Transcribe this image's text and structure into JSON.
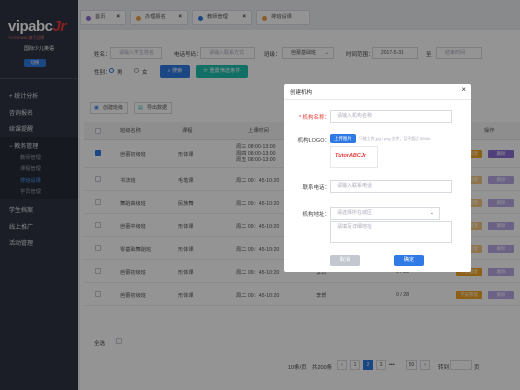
{
  "brand": {
    "logo_main": "vipabc",
    "logo_jr": "Jr",
    "logo_sub": "TUTORABC旗下品牌",
    "school": "国际少儿英语",
    "switch_label": "切换"
  },
  "sidebar": {
    "items": [
      {
        "label": "统计分析",
        "arrow": "+"
      },
      {
        "label": "咨询报名"
      },
      {
        "label": "续课提醒"
      },
      {
        "label": "教务管理",
        "arrow": "−"
      },
      {
        "label": "教师管理"
      },
      {
        "label": "课程管理"
      },
      {
        "label": "排班设课"
      },
      {
        "label": "学员管理"
      },
      {
        "label": "学生档案"
      },
      {
        "label": "线上推广"
      },
      {
        "label": "活动管理"
      }
    ]
  },
  "tabs": [
    {
      "label": "首页",
      "color": "#8e6fd6"
    },
    {
      "label": "办理报名",
      "color": "#f0a04b"
    },
    {
      "label": "教师管理",
      "color": "#2f7ae5"
    },
    {
      "label": "排班设课",
      "color": "#f0a04b"
    }
  ],
  "filters": {
    "name_label": "姓名：",
    "name_placeholder": "请输入学生姓名",
    "phone_label": "电话号码：",
    "phone_placeholder": "请输入联系方式",
    "class_label": "班级：",
    "class_value": "芭蕾基础班",
    "time_label": "时间范围：",
    "time_start": "2017-5-31",
    "time_sep": "至",
    "time_end_placeholder": "结束时间",
    "gender_label": "性别：",
    "gender_male": "男",
    "gender_female": "女",
    "search_button": "搜索",
    "reset_button": "重置筛选条件"
  },
  "toolbar": {
    "create_button": "创建班级",
    "export_button": "导出数据"
  },
  "table": {
    "headers": [
      "班级名称",
      "课程",
      "上课时间",
      "",
      "",
      "",
      "操作"
    ],
    "rows": [
      {
        "name": "芭蕾初级班",
        "course": "形体课",
        "time": "周三 08:00-13:00\n周四 08:00-13:00\n周五 08:00-13:00",
        "checked": true
      },
      {
        "name": "书法班",
        "course": "毛笔课",
        "time": "周二 09：45-10:20",
        "checked": false
      },
      {
        "name": "舞蹈高级班",
        "course": "民族舞",
        "time": "周二 09：45-10:20",
        "checked": false
      },
      {
        "name": "芭蕾中级班",
        "course": "形体课",
        "time": "周二 09：45-10:20",
        "checked": false
      },
      {
        "name": "零基础舞蹈班",
        "course": "形体课",
        "time": "周二 09：45-10:20",
        "checked": false
      },
      {
        "name": "芭蕾初级班",
        "course": "形体课",
        "time": "周二 09：45-10:20",
        "teacher": "李贺",
        "count": "0 / 28",
        "checked": false
      },
      {
        "name": "芭蕾初级班",
        "course": "形体课",
        "time": "周二 09：45-10:20",
        "teacher": "李贺",
        "count": "0 / 28",
        "checked": false
      }
    ],
    "action_manage": "学员管理",
    "action_delete": "删除",
    "select_all": "全选"
  },
  "pager": {
    "per_page": "10条/页",
    "total": "共200条",
    "pages": [
      "1",
      "2",
      "3",
      "•••",
      "50"
    ],
    "goto_label": "转到",
    "goto_suffix": "页"
  },
  "modal": {
    "title": "创建机构",
    "name_label": "* 机构名称：",
    "name_placeholder": "请输入机构名称",
    "logo_label": "机构LOGO：",
    "upload_button": "上传图片",
    "upload_hint": "只能上传 jpg / png 文件，且不超过 500kb",
    "logo_preview": "TutorABCJr",
    "phone_label": "联系电话：",
    "phone_placeholder": "请输入联系电话",
    "address_label": "机构地址：",
    "address_placeholder": "请选择所在城区",
    "address_detail_placeholder": "请填写详细地址",
    "cancel_button": "取消",
    "confirm_button": "确定"
  }
}
